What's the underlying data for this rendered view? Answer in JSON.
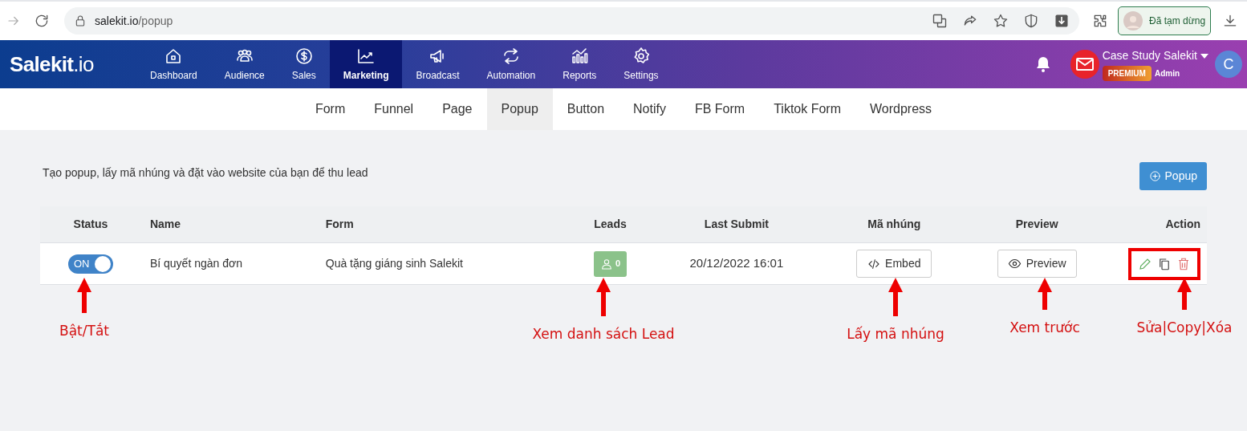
{
  "browser": {
    "url_host": "salekit.io",
    "url_path": "/popup",
    "profile_status": "Đã tạm dừng"
  },
  "logo": {
    "main": "Salekit",
    "suffix": ".io"
  },
  "nav": [
    {
      "label": "Dashboard",
      "selected": false
    },
    {
      "label": "Audience",
      "selected": false
    },
    {
      "label": "Sales",
      "selected": false
    },
    {
      "label": "Marketing",
      "selected": true
    },
    {
      "label": "Broadcast",
      "selected": false
    },
    {
      "label": "Automation",
      "selected": false
    },
    {
      "label": "Reports",
      "selected": false
    },
    {
      "label": "Settings",
      "selected": false
    }
  ],
  "account": {
    "name": "Case Study Salekit",
    "badge": "PREMIUM",
    "role": "Admin",
    "avatar_letter": "C"
  },
  "subnav": [
    {
      "label": "Form",
      "selected": false
    },
    {
      "label": "Funnel",
      "selected": false
    },
    {
      "label": "Page",
      "selected": false
    },
    {
      "label": "Popup",
      "selected": true
    },
    {
      "label": "Button",
      "selected": false
    },
    {
      "label": "Notify",
      "selected": false
    },
    {
      "label": "FB Form",
      "selected": false
    },
    {
      "label": "Tiktok Form",
      "selected": false
    },
    {
      "label": "Wordpress",
      "selected": false
    }
  ],
  "description": "Tạo popup, lấy mã nhúng và đặt vào website của bạn để thu lead",
  "add_button": "Popup",
  "table": {
    "columns": [
      "Status",
      "Name",
      "Form",
      "Leads",
      "Last Submit",
      "Mã nhúng",
      "Preview",
      "Action"
    ],
    "rows": [
      {
        "status_label": "ON",
        "on": true,
        "name": "Bí quyết ngàn đơn",
        "form": "Quà tặng giáng sinh Salekit",
        "leads": "0",
        "last_submit": "20/12/2022 16:01",
        "embed": "Embed",
        "preview": "Preview"
      }
    ]
  },
  "annotations": [
    "Bật/Tắt",
    "Xem danh sách Lead",
    "Lấy mã nhúng",
    "Xem trước",
    "Sửa|Copy|Xóa"
  ]
}
